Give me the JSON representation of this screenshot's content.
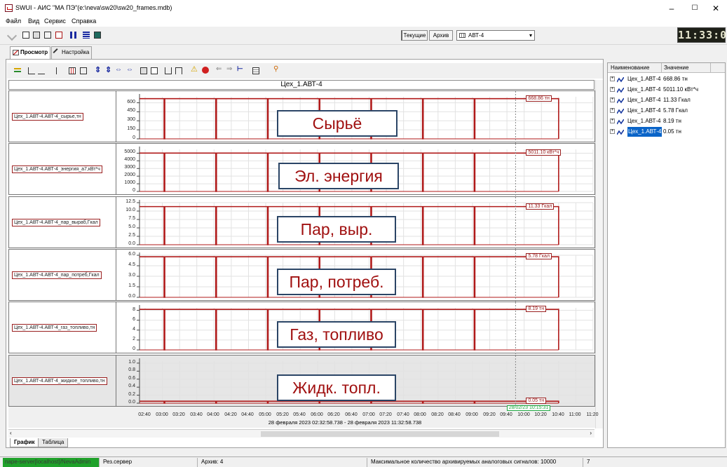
{
  "window": {
    "title": "SWUI - АИС \"МА ПЭ\"(e:\\neva\\sw20\\sw20_frames.mdb)",
    "minimize": "–",
    "maximize": "☐",
    "close": "✕"
  },
  "menu": [
    "Файл",
    "Вид",
    "Сервис",
    "Справка"
  ],
  "toolbar": {
    "current_label": "Текущие",
    "archive_label": "Архив",
    "object_value": "АВТ-4",
    "clock": "11:33:00"
  },
  "tabs": [
    "Просмотр",
    "Настройка"
  ],
  "chart_data": {
    "type": "line",
    "title": "Цех_1.АВТ-4",
    "x_ticks": [
      "02:40",
      "03:00",
      "03:20",
      "03:40",
      "04:00",
      "04:20",
      "04:40",
      "05:00",
      "05:20",
      "05:40",
      "06:00",
      "06:20",
      "06:40",
      "07:00",
      "07:20",
      "07:40",
      "08:00",
      "08:20",
      "08:40",
      "09:00",
      "09:20",
      "09:40",
      "10:00",
      "10:20",
      "10:40",
      "11:00",
      "11:20"
    ],
    "range_text": "28 февраля 2023 02:32:58.738 - 28 февраля 2023 11:32:58.738",
    "cursor_time": "28/02/23 10:15:31",
    "series_color": "#b01a1a",
    "panels": [
      {
        "name": "Цех_1.АВТ-4.АВТ-4_сырье,тн",
        "overlay": "Сырьё",
        "current_value": "668.86 тн",
        "y_ticks": [
          "600",
          "450",
          "300",
          "150",
          "0"
        ],
        "ylim": [
          0,
          700
        ],
        "level": 668.86
      },
      {
        "name": "Цех_1.АВТ-4.АВТ-4_энергия_а7,кВт*ч",
        "overlay": "Эл. энергия",
        "current_value": "5011.10 кВт*ч",
        "y_ticks": [
          "5000",
          "4000",
          "3000",
          "2000",
          "1000",
          "0"
        ],
        "ylim": [
          0,
          5500
        ],
        "level": 5011.1
      },
      {
        "name": "Цех_1.АВТ-4.АВТ-4_пар_выраб,Гкал",
        "overlay": "Пар, выр.",
        "current_value": "11.33 Гкал",
        "y_ticks": [
          "12.5",
          "10.0",
          "7.5",
          "5.0",
          "2.5",
          "0.0"
        ],
        "ylim": [
          0,
          12.5
        ],
        "level": 11.33
      },
      {
        "name": "Цех_1.АВТ-4.АВТ-4_пар_потреб,Гкал",
        "overlay": "Пар, потреб.",
        "current_value": "5.78 Гкал",
        "y_ticks": [
          "6.0",
          "4.5",
          "3.0",
          "1.5",
          "0.0"
        ],
        "ylim": [
          0,
          6.0
        ],
        "level": 5.78
      },
      {
        "name": "Цех_1.АВТ-4.АВТ-4_газ_топливо,тн",
        "overlay": "Газ, топливо",
        "current_value": "8.19 тн",
        "y_ticks": [
          "8",
          "6",
          "4",
          "2",
          "0"
        ],
        "ylim": [
          0,
          8.5
        ],
        "level": 8.19
      },
      {
        "name": "Цех_1.АВТ-4.АВТ-4_жидкое_топливо,тн",
        "overlay": "Жидк. топл.",
        "current_value": "0.05 тн",
        "y_ticks": [
          "1.0",
          "0.8",
          "0.6",
          "0.4",
          "0.2",
          "0.0"
        ],
        "ylim": [
          0,
          1.05
        ],
        "level": 0.05
      }
    ]
  },
  "bottom_tabs": [
    "График",
    "Таблица"
  ],
  "list": {
    "col_name": "Наименование",
    "col_value": "Значение",
    "rows": [
      {
        "name": "Цех_1.АВТ-4",
        "value": "668.86 тн"
      },
      {
        "name": "Цех_1.АВТ-4",
        "value": "5011.10 кВт*ч"
      },
      {
        "name": "Цех_1.АВТ-4",
        "value": "11.33 Гкал"
      },
      {
        "name": "Цех_1.АВТ-4",
        "value": "5.78 Гкал"
      },
      {
        "name": "Цех_1.АВТ-4",
        "value": "8.19 тн"
      },
      {
        "name": "Цех_1.АВТ-4",
        "value": "0.05 тн"
      }
    ]
  },
  "status": {
    "server": "nape-server[localhost]/NevaAdmin",
    "role": "Рез.сервер",
    "archive": "Архив: 4",
    "max_signals": "Максимальное количество архивируемых аналоговых сигналов: 10000",
    "count": "7"
  }
}
